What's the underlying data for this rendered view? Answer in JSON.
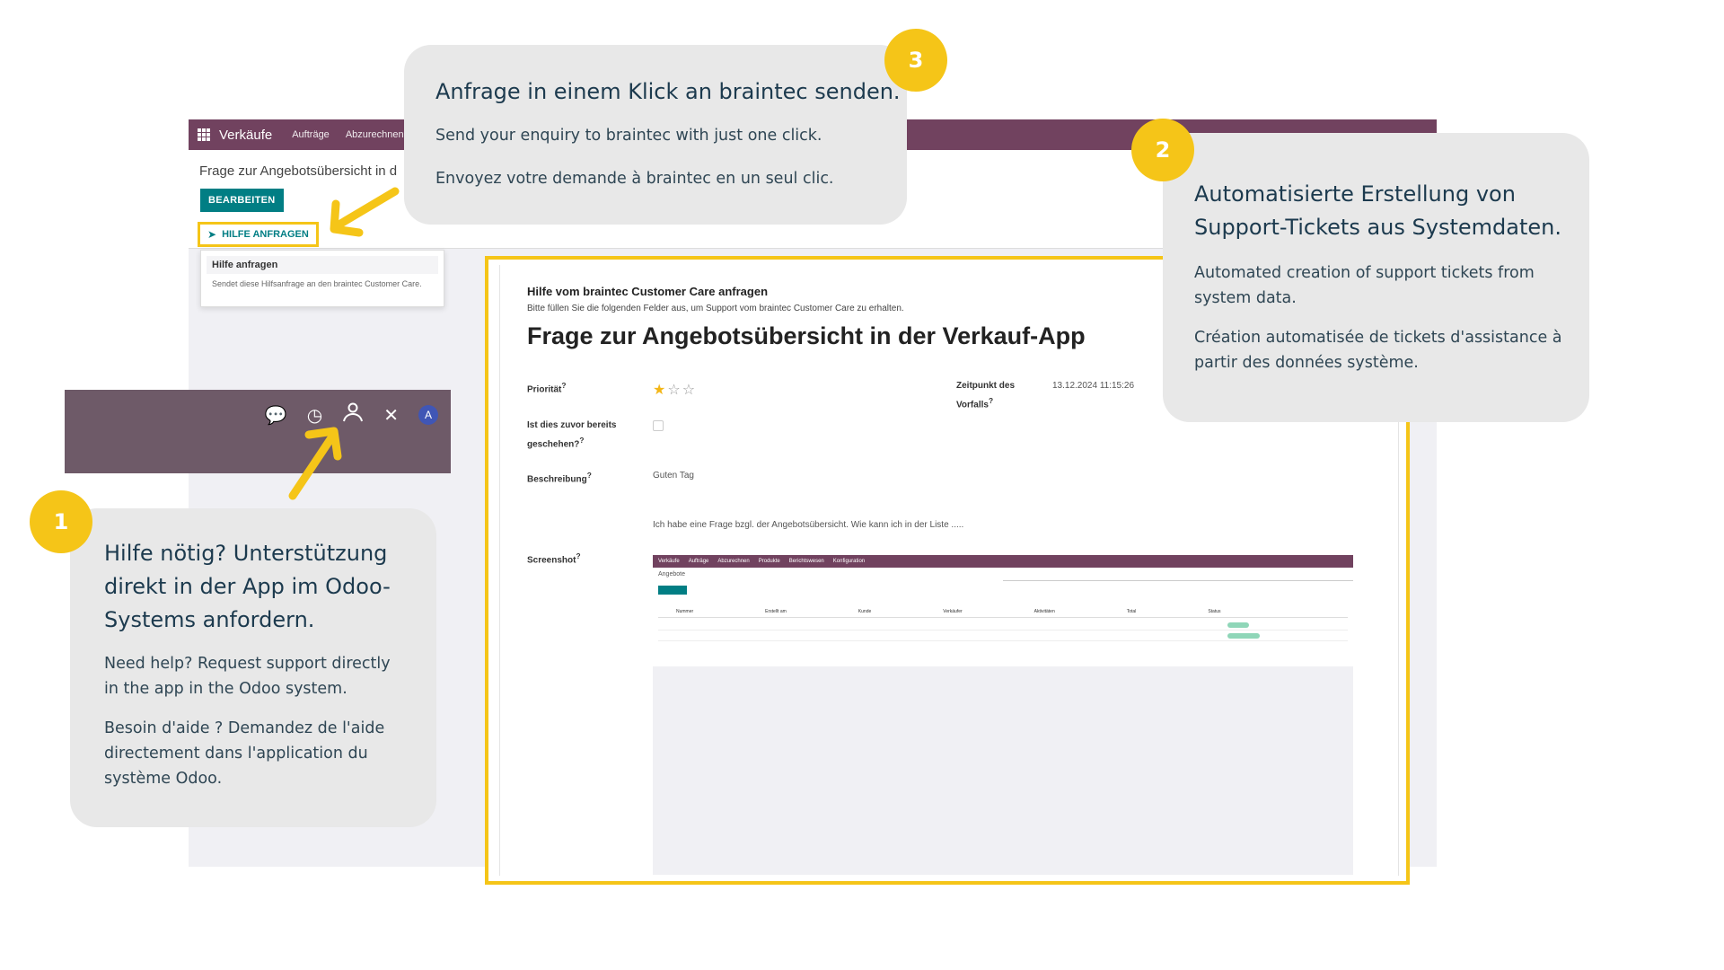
{
  "app": {
    "name": "Verkäufe",
    "menu": [
      "Aufträge",
      "Abzurechnen"
    ],
    "breadcrumb": "Frage zur Angebotsübersicht in d",
    "edit_label": "BEARBEITEN",
    "help_button_label": "HILFE ANFRAGEN",
    "dropdown": {
      "title": "Hilfe anfragen",
      "description": "Sendet diese Hilfsanfrage an den braintec Customer Care."
    }
  },
  "systray": {
    "icons": [
      "chat-icon",
      "clock-icon",
      "support-person-icon",
      "tools-icon"
    ],
    "avatar_letter": "A"
  },
  "form": {
    "heading": "Hilfe vom braintec Customer Care anfragen",
    "subheading": "Bitte füllen Sie die folgenden Felder aus, um Support vom braintec Customer Care zu erhalten.",
    "title": "Frage zur Angebotsübersicht in der Verkauf-App",
    "priority_label": "Priorität",
    "priority_value": 1,
    "priority_max": 3,
    "time_label_1": "Zeitpunkt des",
    "time_label_2": "Vorfalls",
    "time_value": "13.12.2024 11:15:26",
    "before_label_1": "Ist dies zuvor bereits",
    "before_label_2": "geschehen?",
    "description_label": "Beschreibung",
    "description_line1": "Guten Tag",
    "description_line2": "Ich habe eine Frage bzgl. der Angebotsübersicht. Wie kann ich in der Liste .....",
    "screenshot_label": "Screenshot",
    "help_mark": "?"
  },
  "screenshot_mini": {
    "app_name": "Verkäufe",
    "menu": [
      "Aufträge",
      "Abzurechnen",
      "Produkte",
      "Berichtswesen",
      "Konfiguration"
    ],
    "crumb": "Angebote",
    "columns": [
      "Nummer",
      "Erstellt am",
      "Kunde",
      "Verkäufer",
      "Aktivitäten",
      "Total",
      "Status"
    ]
  },
  "callouts": [
    {
      "number": "3",
      "title": "Anfrage in einem Klick an braintec senden.",
      "en": "Send your enquiry to braintec with just one click.",
      "fr": "Envoyez votre demande à braintec en un seul clic."
    },
    {
      "number": "2",
      "title": "Automatisierte Erstellung von Support-Tickets aus Systemdaten.",
      "en": "Automated creation of support tickets from system data.",
      "fr": "Création automatisée de tickets d'assistance à partir des données système."
    },
    {
      "number": "1",
      "title": "Hilfe nötig? Unterstützung direkt in der App im Odoo-Systems anfordern.",
      "en": "Need help? Request support directly in the app in the Odoo system.",
      "fr": "Besoin d'aide ? Demandez de l'aide directement dans l'application du système Odoo."
    }
  ],
  "colors": {
    "accent_yellow": "#f5c518",
    "odoo_purple": "#71425f",
    "odoo_teal": "#017e84",
    "callout_bg": "#e8e8e8"
  }
}
